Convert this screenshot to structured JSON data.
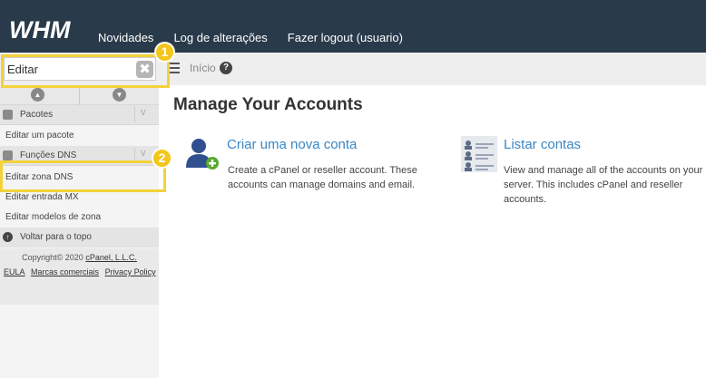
{
  "topbar": {
    "logo_text": "WHM",
    "nav": [
      "Novidades",
      "Log de alterações",
      "Fazer logout (usuario)"
    ]
  },
  "sidebar": {
    "search_value": "Editar",
    "clear_glyph": "✖",
    "sections": [
      {
        "label": "Pacotes",
        "items": [
          "Editar um pacote"
        ]
      },
      {
        "label": "Funções DNS",
        "items": [
          "Editar zona DNS",
          "Editar entrada MX",
          "Editar modelos de zona"
        ]
      }
    ],
    "back_to_top": "Voltar para o topo",
    "copyright": "Copyright© 2020",
    "copyright_link": "cPanel, L.L.C.",
    "footer_links": [
      "EULA",
      "Marcas comerciais",
      "Privacy Policy"
    ]
  },
  "breadcrumb": {
    "home": "Início",
    "help_glyph": "?"
  },
  "main": {
    "title": "Manage Your Accounts",
    "cards": [
      {
        "title": "Criar uma nova conta",
        "desc": "Create a cPanel or reseller account. These accounts can manage domains and email.",
        "icon": "add-user-icon"
      },
      {
        "title": "Listar contas",
        "desc": "View and manage all of the accounts on your server. This includes cPanel and reseller accounts.",
        "icon": "list-accounts-icon"
      }
    ]
  },
  "annotations": [
    "1",
    "2"
  ],
  "colors": {
    "topbar": "#293a4a",
    "link": "#3a87c5",
    "highlight": "#f3d23a",
    "badge": "#f3c61a"
  }
}
